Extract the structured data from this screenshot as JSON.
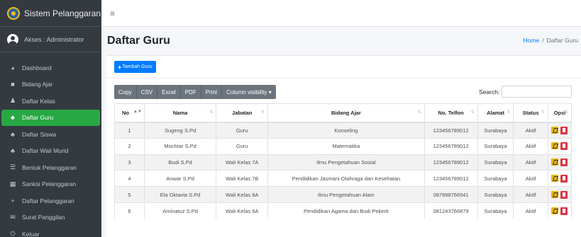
{
  "brand": {
    "title": "Sistem Pelanggaran"
  },
  "user": {
    "label": "Akses : Administrator"
  },
  "sidebar": {
    "items": [
      {
        "label": "Dashboard",
        "icon": "dashboard-icon",
        "glyph": "◕",
        "active": false
      },
      {
        "label": "Bidang Ajar",
        "icon": "book-icon",
        "glyph": "■",
        "active": false
      },
      {
        "label": "Daftar Kelas",
        "icon": "class-icon",
        "glyph": "♟",
        "active": false
      },
      {
        "label": "Daftar Guru",
        "icon": "users-icon",
        "glyph": "♣",
        "active": true
      },
      {
        "label": "Daftar Siswa",
        "icon": "users-icon",
        "glyph": "♣",
        "active": false
      },
      {
        "label": "Daftar Wali Murid",
        "icon": "users-icon",
        "glyph": "♣",
        "active": false
      },
      {
        "label": "Bentuk Pelanggaran",
        "icon": "list-icon",
        "glyph": "☰",
        "active": false
      },
      {
        "label": "Sanksi Pelanggaran",
        "icon": "table-icon",
        "glyph": "▦",
        "active": false
      },
      {
        "label": "Daftar Pelanggaran",
        "icon": "plus-icon",
        "glyph": "+",
        "active": false
      },
      {
        "label": "Surat Panggilan",
        "icon": "mail-icon",
        "glyph": "✉",
        "active": false
      },
      {
        "label": "Keluar",
        "icon": "power-icon",
        "glyph": "⏻",
        "active": false
      }
    ]
  },
  "topbar": {
    "menu_icon": "≡"
  },
  "header": {
    "title": "Daftar Guru"
  },
  "breadcrumb": {
    "home": "Home",
    "separator": "/",
    "current": "Daftar Guru"
  },
  "toolbar": {
    "add_label": "Tambah Guru",
    "add_glyph": "+",
    "export_buttons": [
      "Copy",
      "CSV",
      "Excel",
      "PDF",
      "Print",
      "Column visibility ▾"
    ],
    "search_label": "Search:",
    "search_value": ""
  },
  "table": {
    "columns": [
      "No",
      "Nama",
      "Jabatan",
      "Bidang Ajar",
      "No. Telfon",
      "Alamat",
      "Status",
      "Opsi"
    ],
    "rows": [
      [
        "1",
        "Sugeng S.Pd",
        "Guru",
        "Konseling",
        "123456789012",
        "Surabaya",
        "Aktif"
      ],
      [
        "2",
        "Mochtar S.Pd",
        "Guru",
        "Matematika",
        "123456789012",
        "Surabaya",
        "Aktif"
      ],
      [
        "3",
        "Budi S.Pd",
        "Wali Kelas 7A",
        "Ilmu Pengetahuan Sosial",
        "123456789012",
        "Surabaya",
        "Aktif"
      ],
      [
        "4",
        "Anwar S.Pd",
        "Wali Kelas 7B",
        "Pendidikan Jasmani Olahraga dan Kesehatan",
        "123456789012",
        "Surabaya",
        "Aktif"
      ],
      [
        "5",
        "Ela Oktavia S.Pd",
        "Wali Kelas 8A",
        "Ilmu Pengetahuan Alam",
        "087898766541",
        "Surabaya",
        "Aktif"
      ],
      [
        "6",
        "Aminatuz S.Pd",
        "Wali Kelas 9A",
        "Pendidikan Agama dan Budi Pekerti",
        "081243766879",
        "Surabaya",
        "Aktif"
      ]
    ]
  },
  "colors": {
    "sidebar": "#343a40",
    "active": "#28a745",
    "primary": "#007bff",
    "edit": "#f0b400",
    "delete": "#dc3545"
  }
}
